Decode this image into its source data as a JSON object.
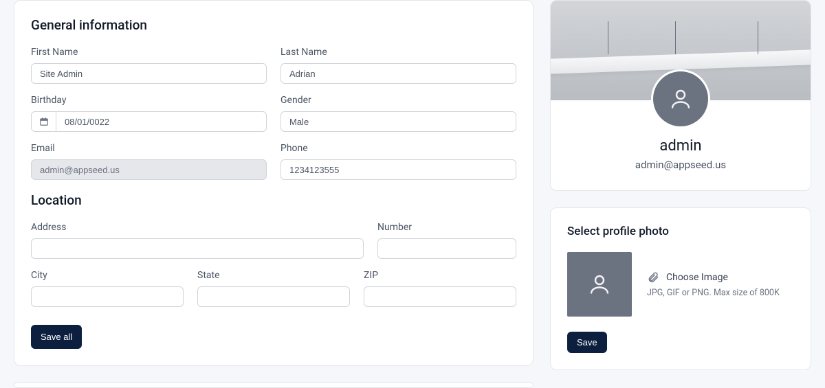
{
  "general": {
    "title": "General information",
    "firstNameLabel": "First Name",
    "firstNameValue": "Site Admin",
    "lastNameLabel": "Last Name",
    "lastNameValue": "Adrian",
    "birthdayLabel": "Birthday",
    "birthdayValue": "08/01/0022",
    "genderLabel": "Gender",
    "genderValue": "Male",
    "emailLabel": "Email",
    "emailValue": "admin@appseed.us",
    "phoneLabel": "Phone",
    "phoneValue": "1234123555"
  },
  "location": {
    "title": "Location",
    "addressLabel": "Address",
    "addressValue": "",
    "numberLabel": "Number",
    "numberValue": "",
    "cityLabel": "City",
    "cityValue": "",
    "stateLabel": "State",
    "stateValue": "",
    "zipLabel": "ZIP",
    "zipValue": ""
  },
  "buttons": {
    "saveAll": "Save all",
    "save": "Save"
  },
  "profile": {
    "name": "admin",
    "email": "admin@appseed.us"
  },
  "photo": {
    "title": "Select profile photo",
    "chooseLabel": "Choose Image",
    "hint": "JPG, GIF or PNG. Max size of 800K"
  }
}
